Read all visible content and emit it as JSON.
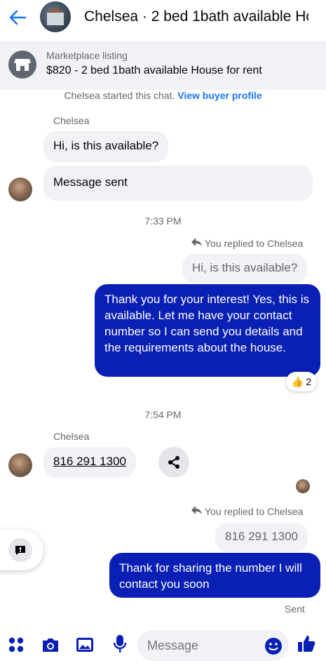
{
  "header": {
    "title": "Chelsea · 2 bed 1bath available Ho"
  },
  "marketplace": {
    "label": "Marketplace listing",
    "listing": "$820 - 2 bed 1bath available House for rent"
  },
  "system_message": {
    "text": "Chelsea started this chat.",
    "link": "View buyer profile"
  },
  "messages": {
    "sender1": "Chelsea",
    "in1": "Hi, is this available?",
    "in2": "Message sent",
    "time1": "7:33 PM",
    "replied1": "You replied to Chelsea",
    "quote1": "Hi, is this available?",
    "out1": "Thank you for your interest! Yes, this is available. Let me have your contact number so I can send you details and the requirements about the house.",
    "reaction_count": "2",
    "time2": "7:54 PM",
    "sender2": "Chelsea",
    "phone": "816 291 1300",
    "replied2": "You replied to Chelsea",
    "quote2": "816 291 1300",
    "out2": "Thank for sharing  the number I will contact you soon",
    "status": "Sent"
  },
  "composer": {
    "placeholder": "Message"
  },
  "colors": {
    "accent": "#1877f2",
    "outgoing_bubble": "#0a1fb4",
    "incoming_bubble": "#f0f2f5"
  },
  "icons": {
    "back": "back-arrow-icon",
    "marketplace": "storefront-icon",
    "reply": "reply-arrow-icon",
    "reaction": "thumbs-up-emoji",
    "share": "share-icon",
    "menu": "apps-grid-icon",
    "camera": "camera-icon",
    "gallery": "gallery-icon",
    "mic": "microphone-icon",
    "emoji": "emoji-icon",
    "like": "thumbs-up-icon",
    "floating": "chat-alert-icon"
  }
}
